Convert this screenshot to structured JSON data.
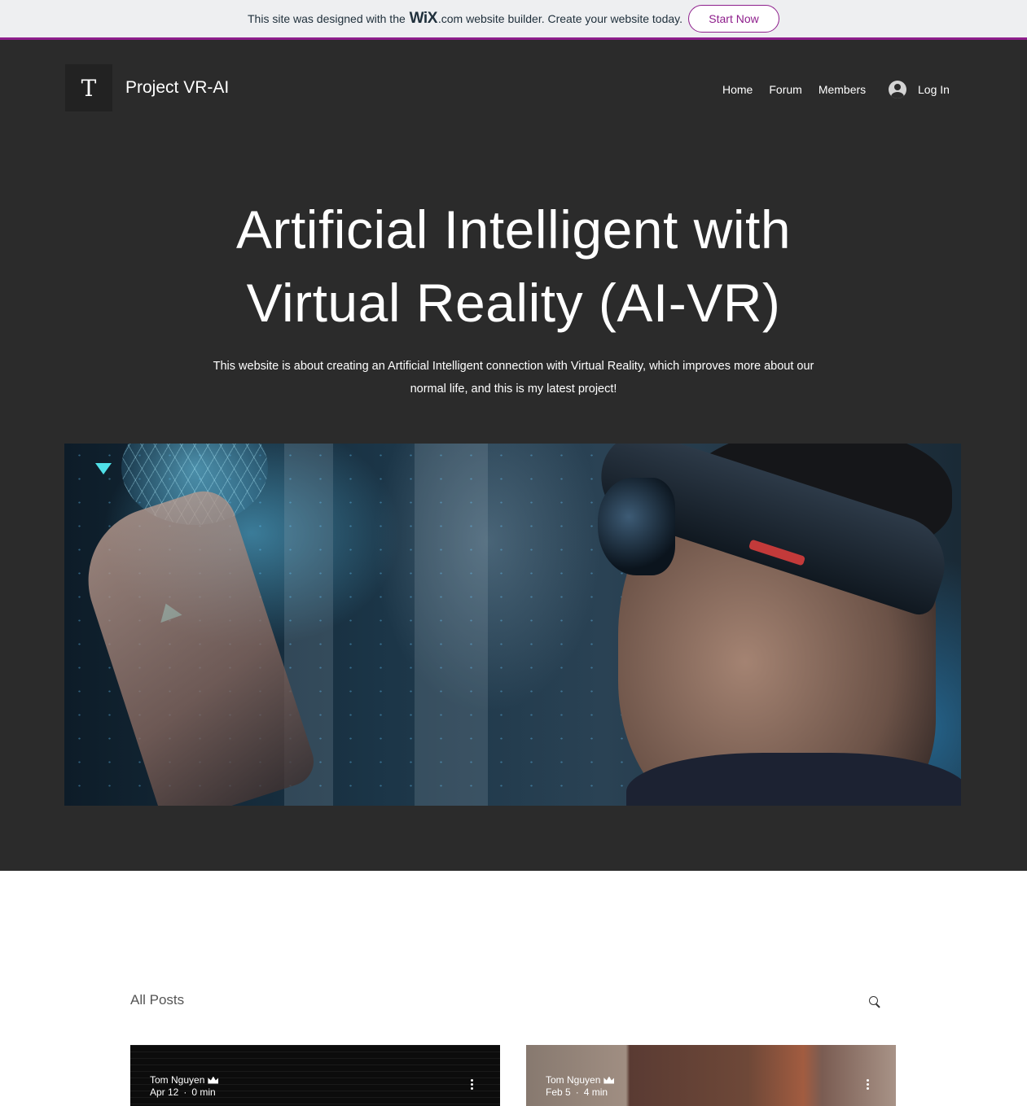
{
  "promo": {
    "text_before": "This site was designed with the",
    "brand": "WiX",
    "brand_domain": ".com",
    "text_after": "website builder. Create your website today.",
    "cta": "Start Now",
    "accent_color": "#8e1e8c"
  },
  "header": {
    "logo_letter": "T",
    "site_title": "Project VR-AI",
    "nav": [
      "Home",
      "Forum",
      "Members"
    ],
    "login_label": "Log In"
  },
  "hero": {
    "headline_line1": "Artificial Intelligent with",
    "headline_line2": "Virtual Reality (AI-VR)",
    "subtitle_line1": "This website is about creating an Artificial Intelligent connection with Virtual Reality, which improves more about our",
    "subtitle_line2": "normal life, and this is my latest project!",
    "background_color": "#2b2b2b"
  },
  "posts": {
    "heading": "All Posts",
    "items": [
      {
        "author": "Tom Nguyen",
        "date": "Apr 12",
        "read_time": "0 min"
      },
      {
        "author": "Tom Nguyen",
        "date": "Feb 5",
        "read_time": "4 min"
      }
    ]
  }
}
